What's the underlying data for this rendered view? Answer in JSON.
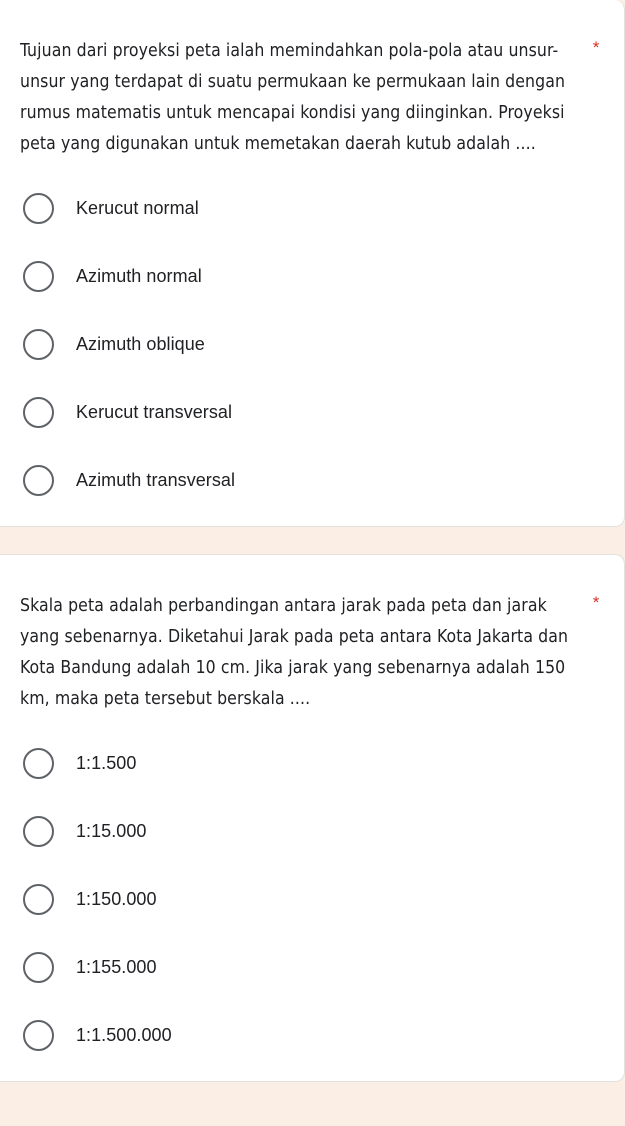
{
  "theme": {
    "page_background": "#faeee5",
    "card_background": "#ffffff",
    "card_border": "#e3e1de",
    "text_color": "#202124",
    "required_marker_color": "#d93025",
    "radio_border_color": "#5f6368"
  },
  "questions": [
    {
      "id": "q1",
      "required_marker": "*",
      "text": "Tujuan dari proyeksi peta ialah memindahkan pola-pola atau unsur-unsur yang terdapat di suatu permukaan ke permukaan lain dengan rumus matematis untuk mencapai kondisi yang diinginkan. Proyeksi peta yang digunakan untuk memetakan daerah kutub adalah ....",
      "options": [
        {
          "label": "Kerucut normal",
          "selected": false
        },
        {
          "label": "Azimuth normal",
          "selected": false
        },
        {
          "label": "Azimuth oblique",
          "selected": false
        },
        {
          "label": "Kerucut transversal",
          "selected": false
        },
        {
          "label": "Azimuth transversal",
          "selected": false
        }
      ]
    },
    {
      "id": "q2",
      "required_marker": "*",
      "text": "Skala peta adalah perbandingan antara jarak pada peta dan jarak yang sebenarnya. Diketahui Jarak pada peta antara Kota Jakarta dan Kota Bandung adalah 10 cm. Jika jarak yang sebenarnya adalah 150 km, maka peta tersebut berskala ....",
      "options": [
        {
          "label": "1:1.500",
          "selected": false
        },
        {
          "label": "1:15.000",
          "selected": false
        },
        {
          "label": "1:150.000",
          "selected": false
        },
        {
          "label": "1:155.000",
          "selected": false
        },
        {
          "label": "1:1.500.000",
          "selected": false
        }
      ]
    }
  ]
}
